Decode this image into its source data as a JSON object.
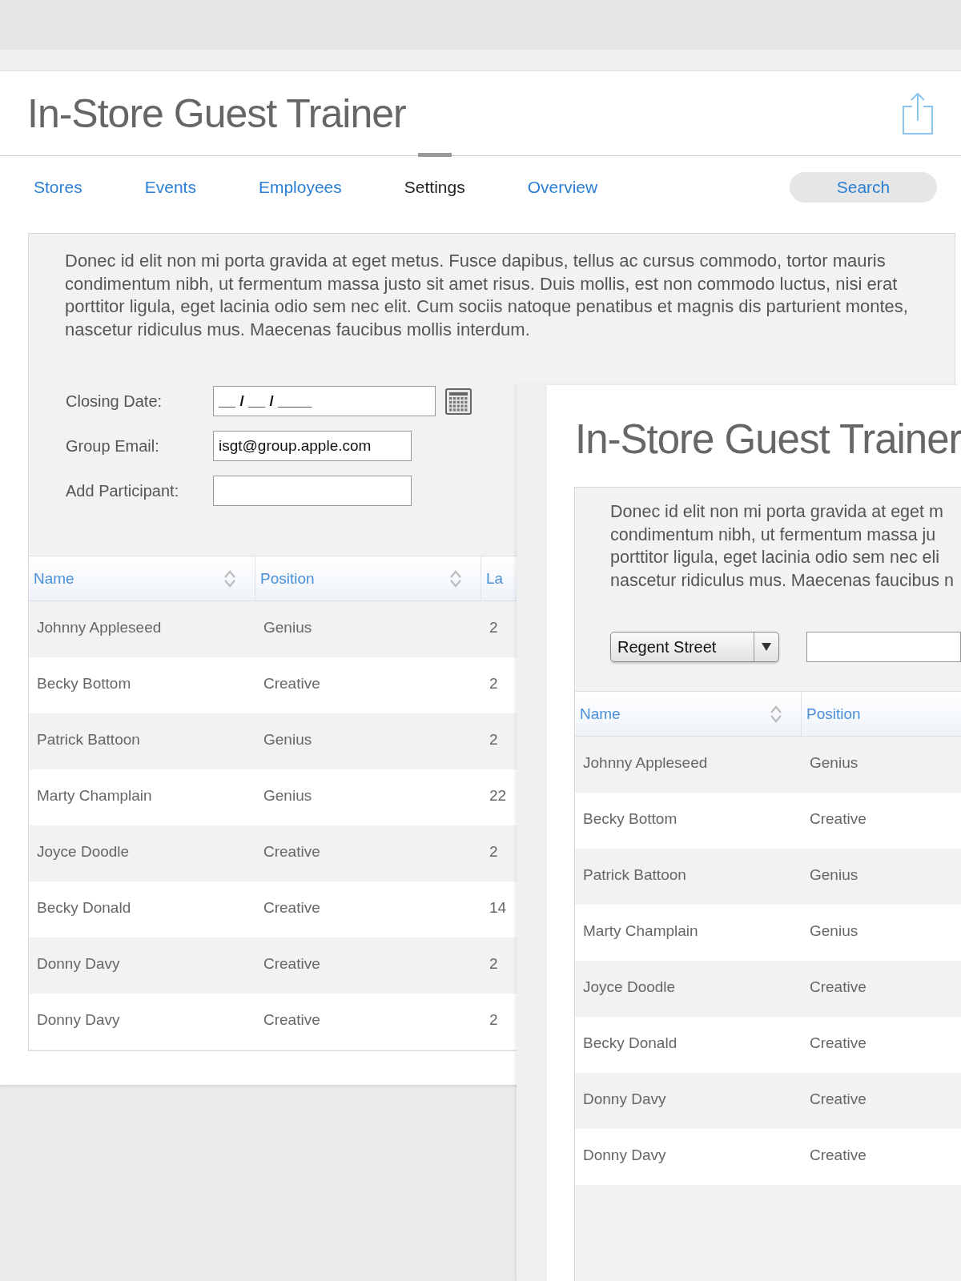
{
  "main_window": {
    "title": "In-Store Guest Trainer",
    "tabs": [
      {
        "label": "Stores",
        "selected": false
      },
      {
        "label": "Events",
        "selected": false
      },
      {
        "label": "Employees",
        "selected": false
      },
      {
        "label": "Settings",
        "selected": true
      },
      {
        "label": "Overview",
        "selected": false
      }
    ],
    "search_button": "Search",
    "description_lines": [
      "Donec id elit non mi porta gravida at eget metus. Fusce dapibus, tellus ac cursus commodo, tortor mauris",
      "condimentum nibh, ut fermentum massa justo sit amet risus. Duis mollis, est non commodo luctus, nisi erat",
      "porttitor ligula, eget lacinia odio sem nec elit. Cum sociis natoque penatibus et magnis dis parturient montes,",
      "nascetur ridiculus mus. Maecenas faucibus mollis interdum."
    ],
    "form": [
      {
        "kind": "date",
        "label": "Closing Date:",
        "value": "__ / __ / ____"
      },
      {
        "kind": "text",
        "label": "Group Email:",
        "value": "isgt@group.apple.com"
      },
      {
        "kind": "text",
        "label": "Add Participant:"
      }
    ],
    "table": {
      "columns": [
        "Name",
        "Position",
        "La"
      ],
      "rows": [
        [
          "Johnny Appleseed",
          "Genius",
          "2"
        ],
        [
          "Becky Bottom",
          "Creative",
          "2"
        ],
        [
          "Patrick Battoon",
          "Genius",
          "2"
        ],
        [
          "Marty Champlain",
          "Genius",
          "22"
        ],
        [
          "Joyce Doodle",
          "Creative",
          "2"
        ],
        [
          "Becky Donald",
          "Creative",
          "14"
        ],
        [
          "Donny Davy",
          "Creative",
          "2"
        ],
        [
          "Donny Davy",
          "Creative",
          "2"
        ]
      ]
    }
  },
  "overlay_window": {
    "title": "In-Store Guest Trainer",
    "description_lines": [
      "Donec id elit non mi porta gravida at eget m",
      "condimentum nibh, ut fermentum massa ju",
      "porttitor ligula, eget lacinia odio sem nec eli",
      "nascetur ridiculus mus. Maecenas faucibus n"
    ],
    "store_dropdown": "Regent Street",
    "table": {
      "columns": [
        "Name",
        "Position"
      ],
      "rows": [
        [
          "Johnny Appleseed",
          "Genius"
        ],
        [
          "Becky Bottom",
          "Creative"
        ],
        [
          "Patrick Battoon",
          "Genius"
        ],
        [
          "Marty Champlain",
          "Genius"
        ],
        [
          "Joyce Doodle",
          "Creative"
        ],
        [
          "Becky Donald",
          "Creative"
        ],
        [
          "Donny Davy",
          "Creative"
        ],
        [
          "Donny Davy",
          "Creative"
        ]
      ]
    }
  }
}
